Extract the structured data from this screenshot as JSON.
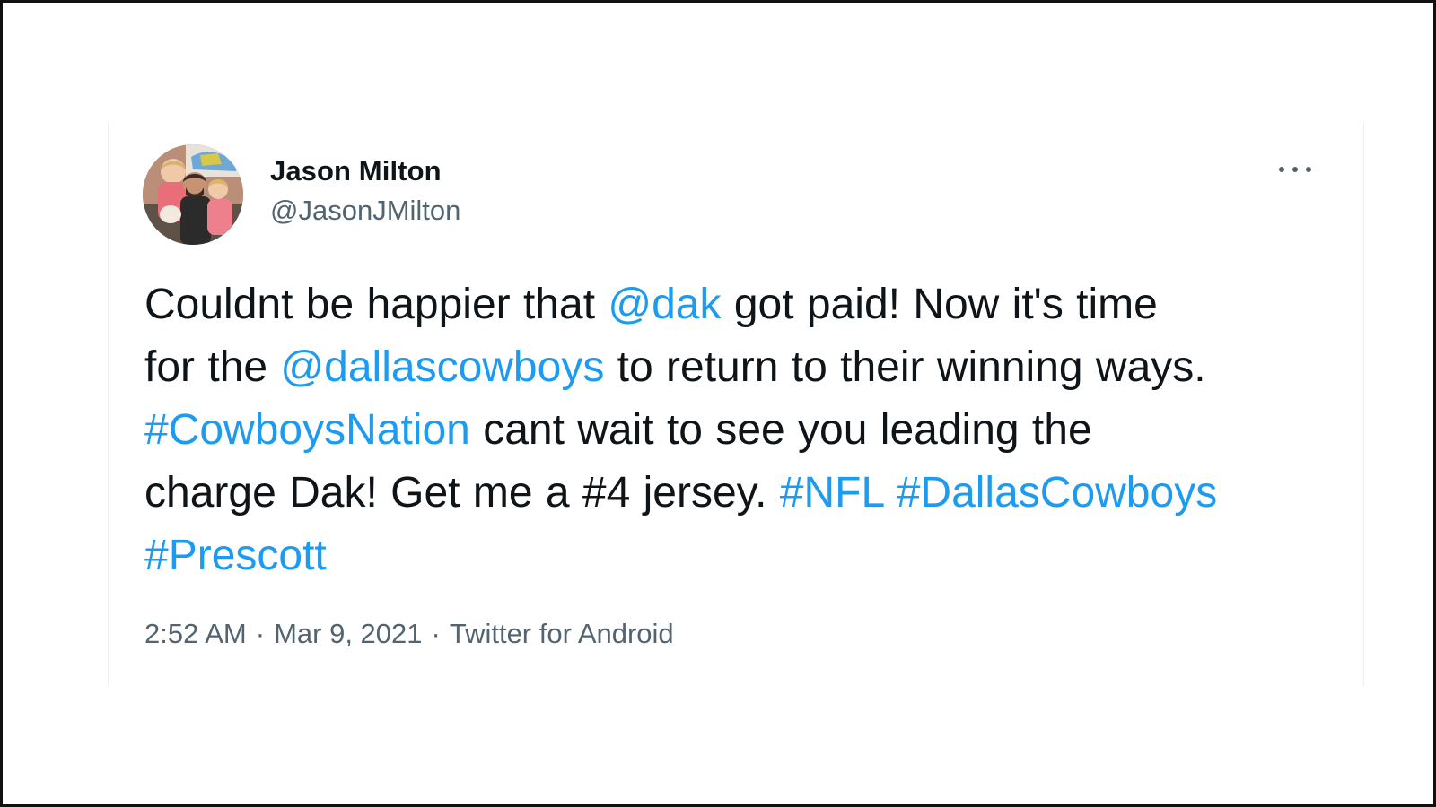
{
  "tweet": {
    "author": {
      "display_name": "Jason Milton",
      "handle": "@JasonJMilton",
      "avatar_icon": "profile-photo-avatar"
    },
    "more_icon": "more-horizontal-icon",
    "text": {
      "line1": {
        "part1": "Couldnt be happier that ",
        "mention_dak": "@dak",
        "part2": " got paid! Now it's time"
      },
      "line2": {
        "part1": "for the ",
        "mention_cowboys": "@dallascowboys",
        "part2": " to return to their winning ways."
      },
      "line3": {
        "hashtag_cowboysnation": "#CowboysNation",
        "part1": " cant wait to see you leading the"
      },
      "line4": {
        "part1": "charge Dak! Get me a #4 jersey. ",
        "hashtag_nfl": "#NFL",
        "hashtag_dallascowboys": "#DallasCowboys"
      },
      "line5": {
        "hashtag_prescott": "#Prescott"
      }
    },
    "meta": {
      "time": "2:52 AM",
      "separator": "·",
      "date": "Mar 9, 2021",
      "source": "Twitter for Android"
    },
    "colors": {
      "link": "#1d9bf0",
      "text": "#0f1419",
      "secondary": "#536471"
    }
  }
}
